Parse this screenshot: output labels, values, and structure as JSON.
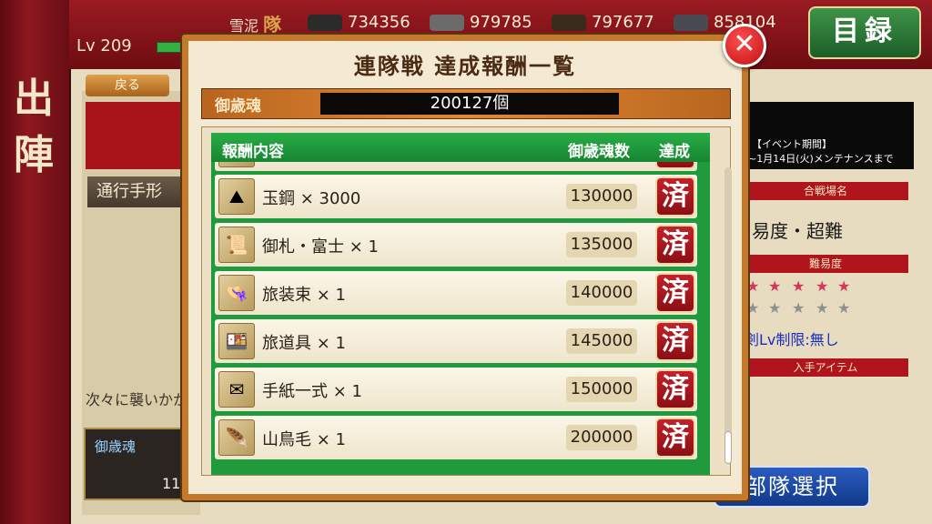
{
  "background": {
    "sortie_chars": [
      "出",
      "陣"
    ],
    "player_name": "雪泥",
    "player_name_mark": "隊",
    "level": "Lv 209",
    "resources": [
      {
        "icon": "charcoal-icon",
        "value": "734356",
        "color": "#2b2b2b"
      },
      {
        "icon": "tamahagane-icon",
        "value": "979785",
        "color": "#6b6b6b"
      },
      {
        "icon": "cooling-material-icon",
        "value": "797677",
        "color": "#3a2a1a"
      },
      {
        "icon": "whetstone-icon",
        "value": "858104",
        "color": "#4a4a52"
      }
    ],
    "catalog_label": "目録",
    "back_label": "戻る",
    "pass_label": "通行手形",
    "attack_text": "次々に襲いかか",
    "spirit_label": "御歳魂",
    "spirit_count": "11",
    "event_period": "【イベント期間】",
    "event_until": "~1月14日(火)メンテナンスまで",
    "battlefield_header": "合戦場名",
    "difficulty_text": "易度・超難",
    "difficulty_header": "難易度",
    "sword_limit": "剣Lv制限:無し",
    "item_header": "入手アイテム",
    "squad_select": "部隊選択"
  },
  "modal": {
    "title": "連隊戦 達成報酬一覧",
    "spirit_label": "御歳魂",
    "spirit_total": "200127個",
    "headers": {
      "content": "報酬内容",
      "count": "御歳魂数",
      "achieved": "達成"
    },
    "achieved_mark": "済",
    "rows": [
      {
        "icon": "tamahagane-icon",
        "name": "玉鋼 × 3000",
        "value": "130000"
      },
      {
        "icon": "talisman-icon",
        "name": "御札・富士 × 1",
        "value": "135000"
      },
      {
        "icon": "travel-clothes-icon",
        "name": "旅装束 × 1",
        "value": "140000"
      },
      {
        "icon": "travel-tools-icon",
        "name": "旅道具 × 1",
        "value": "145000"
      },
      {
        "icon": "letter-set-icon",
        "name": "手紙一式 × 1",
        "value": "150000"
      },
      {
        "icon": "pheasant-feather-icon",
        "name": "山鳥毛 × 1",
        "value": "200000"
      }
    ]
  }
}
